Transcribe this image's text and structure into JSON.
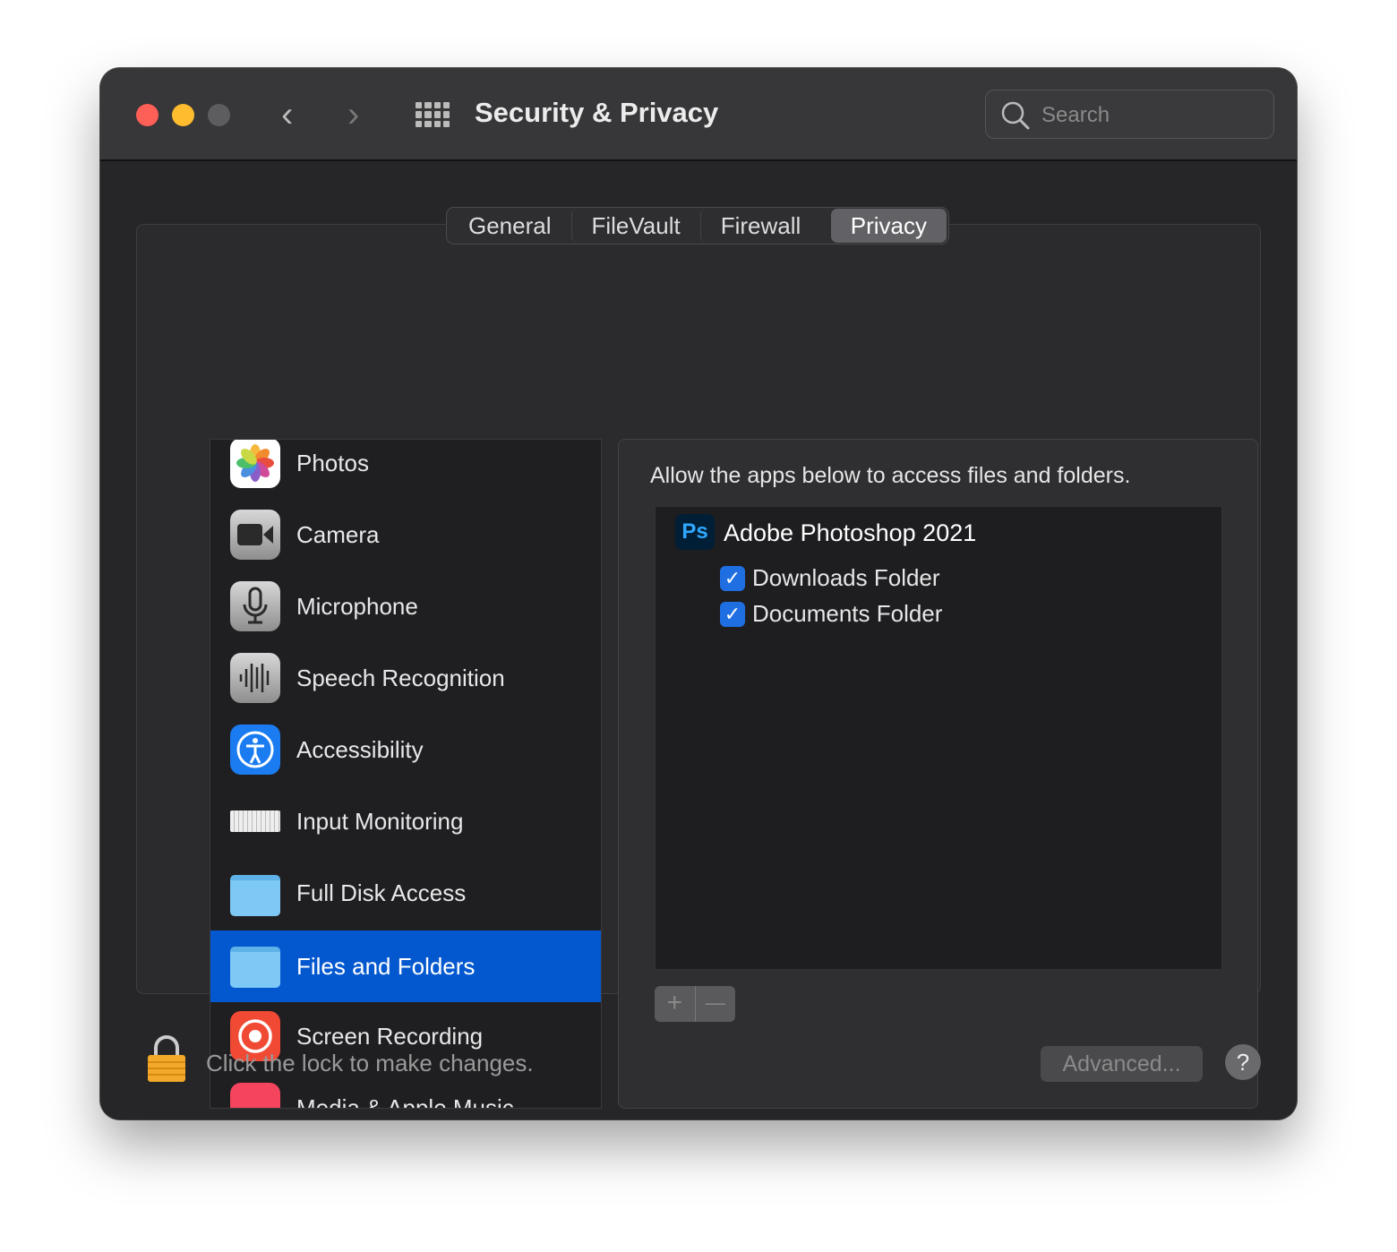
{
  "window": {
    "title": "Security & Privacy",
    "search_placeholder": "Search"
  },
  "tabs": [
    {
      "label": "General"
    },
    {
      "label": "FileVault"
    },
    {
      "label": "Firewall"
    },
    {
      "label": "Privacy",
      "selected": true
    }
  ],
  "sidebar": {
    "items": [
      {
        "label": "Photos",
        "icon": "photos-icon"
      },
      {
        "label": "Camera",
        "icon": "camera-icon"
      },
      {
        "label": "Microphone",
        "icon": "microphone-icon"
      },
      {
        "label": "Speech Recognition",
        "icon": "waveform-icon"
      },
      {
        "label": "Accessibility",
        "icon": "accessibility-icon"
      },
      {
        "label": "Input Monitoring",
        "icon": "keyboard-icon"
      },
      {
        "label": "Full Disk Access",
        "icon": "folder-icon"
      },
      {
        "label": "Files and Folders",
        "icon": "folder-icon",
        "selected": true
      },
      {
        "label": "Screen Recording",
        "icon": "screen-recording-icon"
      },
      {
        "label": "Media & Apple Music",
        "icon": "music-icon"
      }
    ]
  },
  "panel": {
    "description": "Allow the apps below to access files and folders.",
    "app": {
      "icon_text": "Ps",
      "name": "Adobe Photoshop 2021",
      "permissions": [
        {
          "label": "Downloads Folder",
          "checked": true
        },
        {
          "label": "Documents Folder",
          "checked": true
        }
      ]
    },
    "add_label": "+",
    "remove_label": "—"
  },
  "footer": {
    "lock_text": "Click the lock to make changes.",
    "advanced_label": "Advanced...",
    "help_label": "?"
  },
  "colors": {
    "accent": "#0358d0",
    "close": "#fe5f57",
    "minimize": "#febc2e",
    "zoom_disabled": "#5d5c5f"
  }
}
